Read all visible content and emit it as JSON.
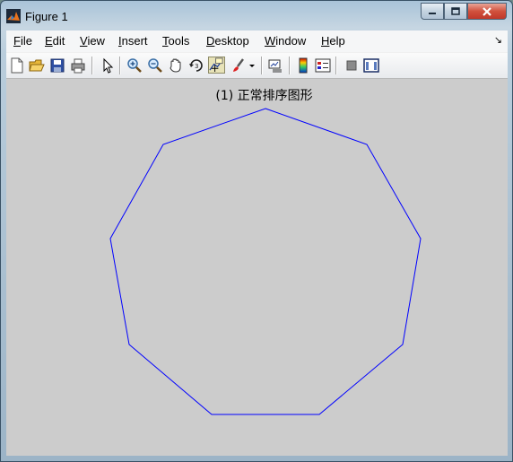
{
  "window": {
    "title": "Figure 1",
    "buttons": [
      "minimize",
      "maximize",
      "close"
    ]
  },
  "menubar": {
    "items": [
      {
        "label": "File",
        "mnemonic": "F"
      },
      {
        "label": "Edit",
        "mnemonic": "E"
      },
      {
        "label": "View",
        "mnemonic": "V"
      },
      {
        "label": "Insert",
        "mnemonic": "I"
      },
      {
        "label": "Tools",
        "mnemonic": "T"
      },
      {
        "label": "Desktop",
        "mnemonic": "D"
      },
      {
        "label": "Window",
        "mnemonic": "W"
      },
      {
        "label": "Help",
        "mnemonic": "H"
      }
    ]
  },
  "toolbar": {
    "icons": [
      "new-figure-icon",
      "open-file-icon",
      "save-icon",
      "print-icon",
      "edit-plot-arrow-icon",
      "zoom-in-icon",
      "zoom-out-icon",
      "pan-hand-icon",
      "rotate-3d-icon",
      "data-cursor-icon",
      "brush-icon",
      "brush-dropdown-icon",
      "link-plot-icon",
      "insert-colorbar-icon",
      "insert-legend-icon",
      "hide-plot-tools-icon",
      "show-plot-tools-icon"
    ]
  },
  "figure": {
    "background": "#cccccc",
    "plot_title": "(1) 正常排序图形",
    "line_color": "#0000ff"
  },
  "colors": {
    "plot_line": "#0000ff",
    "figure_bg": "#cccccc",
    "close_button": "#c9452f"
  }
}
